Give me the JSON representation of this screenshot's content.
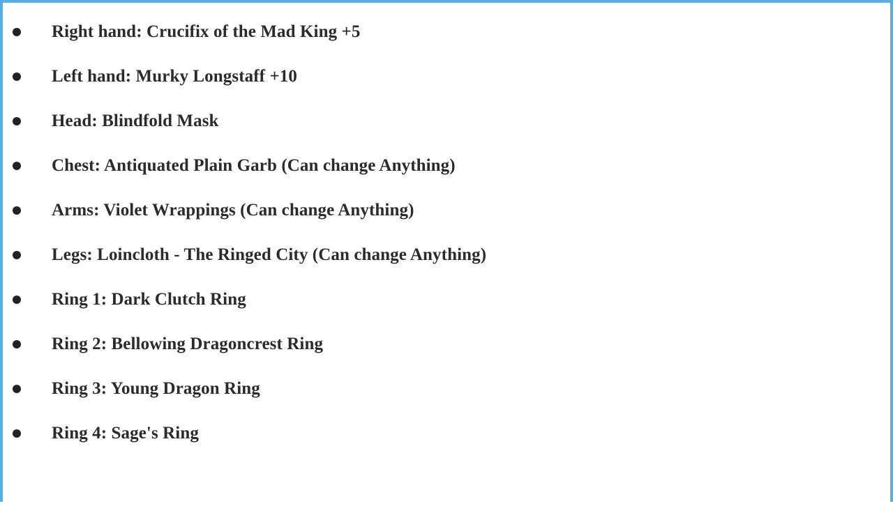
{
  "document": {
    "border_color": "#5fabd4",
    "background_color": "#ffffff",
    "text_color": "#2b2b2b",
    "bullet_color": "#232323",
    "bullet_icon": "bullet-dot-icon"
  },
  "loadout": {
    "items": [
      {
        "label": "Right hand: Crucifix of the Mad King +5"
      },
      {
        "label": "Left hand: Murky Longstaff +10"
      },
      {
        "label": "Head: Blindfold Mask"
      },
      {
        "label": "Chest: Antiquated Plain Garb (Can change Anything)"
      },
      {
        "label": "Arms: Violet Wrappings (Can change Anything)"
      },
      {
        "label": "Legs: Loincloth - The Ringed City (Can change Anything)"
      },
      {
        "label": "Ring 1: Dark Clutch Ring"
      },
      {
        "label": "Ring 2: Bellowing Dragoncrest Ring"
      },
      {
        "label": "Ring 3: Young Dragon Ring"
      },
      {
        "label": "Ring 4: Sage's Ring"
      }
    ]
  }
}
